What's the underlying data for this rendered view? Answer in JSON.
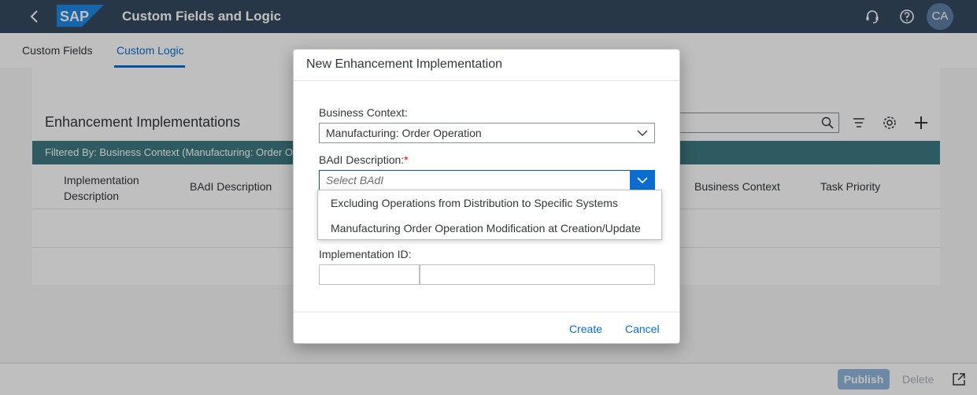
{
  "shell": {
    "title": "Custom Fields and Logic",
    "logo_text": "SAP",
    "avatar": "CA"
  },
  "tabs": [
    {
      "label": "Custom Fields"
    },
    {
      "label": "Custom Logic"
    }
  ],
  "section": {
    "title": "Enhancement Implementations",
    "filter_text": "Filtered By: Business Context (Manufacturing: Order Operation)",
    "columns": [
      "Implementation Description",
      "BAdI Description",
      "Business Context",
      "Task Priority"
    ]
  },
  "dialog": {
    "title": "New Enhancement Implementation",
    "business_context_label": "Business Context:",
    "business_context_value": "Manufacturing: Order Operation",
    "badi_label": "BAdI Description:",
    "badi_placeholder": "Select BAdI",
    "badi_options": [
      "Excluding Operations from Distribution to Specific Systems",
      "Manufacturing Order Operation Modification at Creation/Update"
    ],
    "implementation_id_label": "Implementation ID:",
    "create_label": "Create",
    "cancel_label": "Cancel"
  },
  "footer": {
    "publish_label": "Publish",
    "delete_label": "Delete"
  },
  "colors": {
    "shell": "#354a5f",
    "accent": "#0a6ed1",
    "filter_bar": "#3e7a82"
  }
}
